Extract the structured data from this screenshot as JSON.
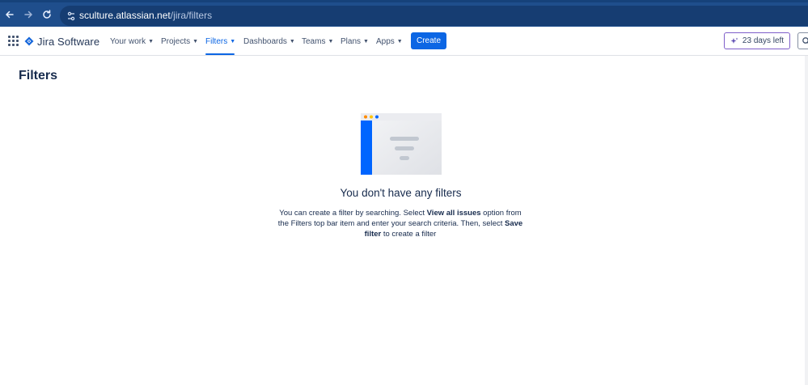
{
  "browser": {
    "url_host": "sculture.atlassian.net",
    "url_path": "/jira/filters",
    "back_icon": "arrow-left-icon",
    "forward_icon": "arrow-right-icon",
    "reload_icon": "reload-icon",
    "site_info_icon": "tune-icon"
  },
  "header": {
    "product_name": "Jira Software",
    "nav_items": [
      {
        "label": "Your work",
        "active": false
      },
      {
        "label": "Projects",
        "active": false
      },
      {
        "label": "Filters",
        "active": true
      },
      {
        "label": "Dashboards",
        "active": false
      },
      {
        "label": "Teams",
        "active": false
      },
      {
        "label": "Plans",
        "active": false
      },
      {
        "label": "Apps",
        "active": false
      }
    ],
    "create_label": "Create",
    "trial_label": "23 days left",
    "accent_color": "#0c66e4"
  },
  "page": {
    "title": "Filters"
  },
  "empty_state": {
    "title": "You don't have any filters",
    "desc_part1": "You can create a filter by searching. Select ",
    "desc_bold1": "View all issues",
    "desc_part2": " option from the Filters top bar item and enter your search criteria. Then, select ",
    "desc_bold2": "Save filter",
    "desc_part3": " to create a filter"
  }
}
